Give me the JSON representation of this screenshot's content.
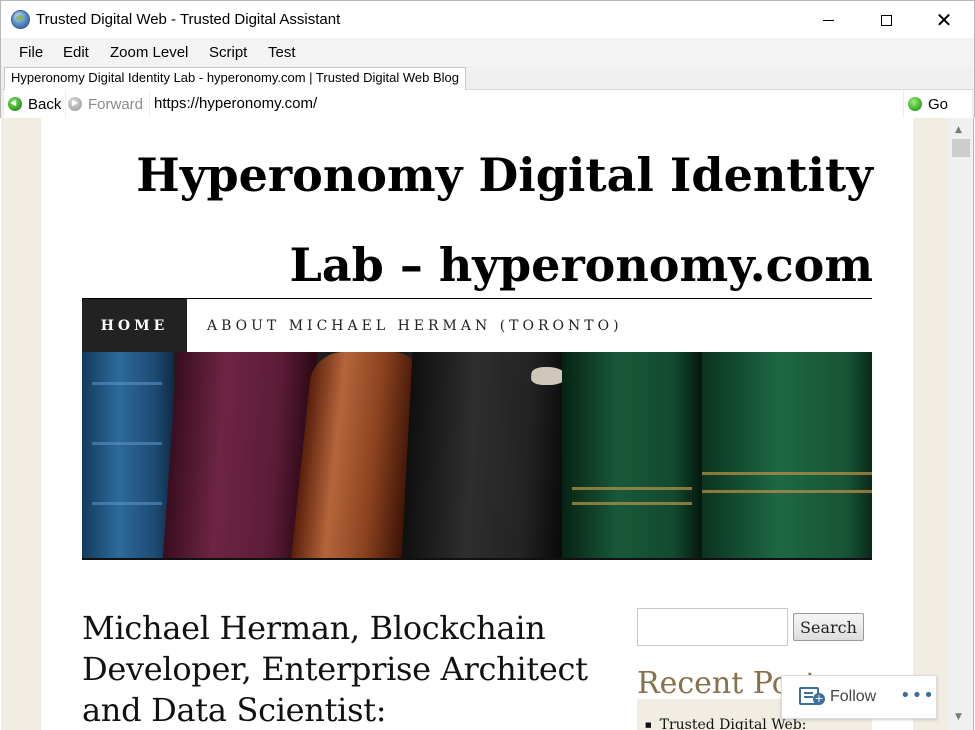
{
  "window": {
    "title": "Trusted Digital Web - Trusted Digital Assistant",
    "close_glyph": "✕"
  },
  "menu": {
    "file": "File",
    "edit": "Edit",
    "zoom": "Zoom Level",
    "script": "Script",
    "test": "Test"
  },
  "tab": {
    "label": "Hyperonomy Digital Identity Lab - hyperonomy.com | Trusted Digital Web Blog"
  },
  "nav": {
    "back_label": "Back",
    "forward_label": "Forward",
    "address": "https://hyperonomy.com/",
    "go_label": "Go"
  },
  "page": {
    "site_title_line1": "Hyperonomy Digital Identity",
    "site_title_line2": "Lab – hyperonomy.com",
    "menu_home": "HOME",
    "menu_about": "ABOUT MICHAEL HERMAN (TORONTO)",
    "post_title": "Michael Herman, Blockchain Developer, Enterprise Architect and Data Scientist:",
    "search_button": "Search",
    "recent_heading": "Recent Posts",
    "recent_items": [
      "Trusted Digital Web:"
    ]
  },
  "follow": {
    "label": "Follow",
    "more": "•••"
  },
  "colors": {
    "page_background": "#f1ede3",
    "nav_home_bg": "#222222",
    "sidebar_heading": "#86714a",
    "follow_accent": "#3c6e9e"
  }
}
